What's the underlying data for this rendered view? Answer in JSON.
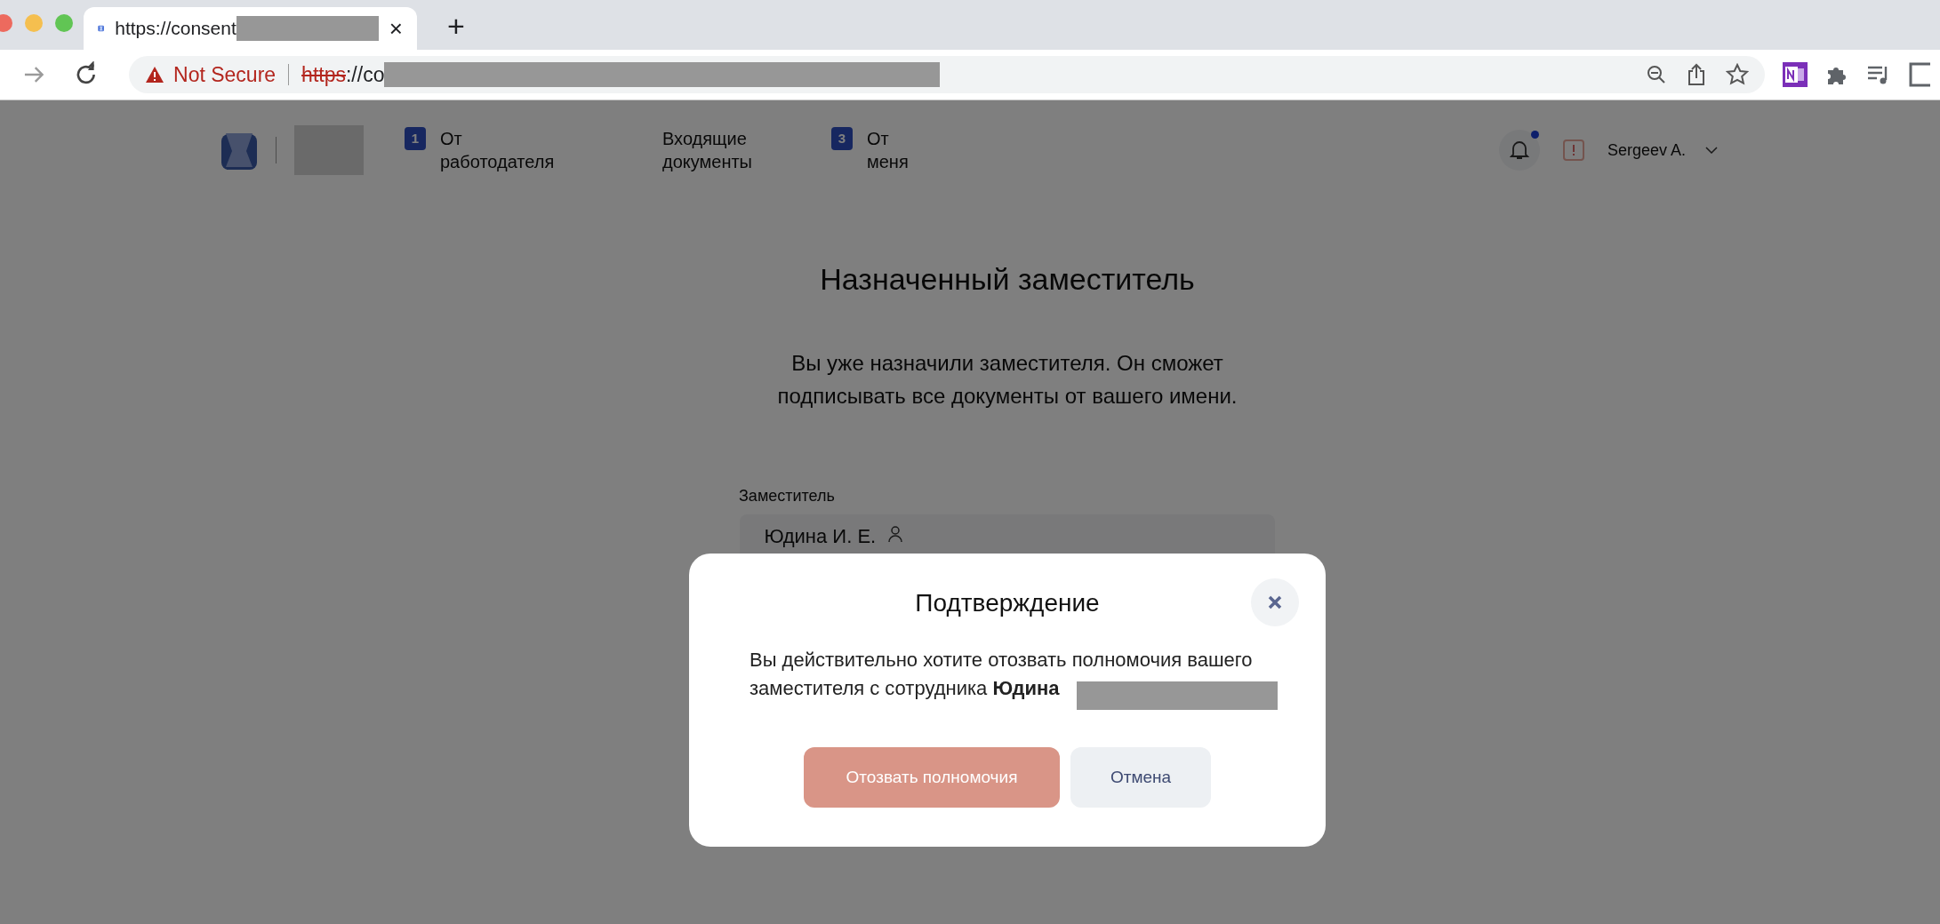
{
  "browser": {
    "tab_title": "https://consent",
    "tab_close": "×",
    "new_tab": "+",
    "security": "Not Secure",
    "url_scheme": "https",
    "url_rest": "://co"
  },
  "header": {
    "nav": [
      {
        "badge": "1",
        "label": "От работодателя"
      },
      {
        "label": "Входящие документы"
      },
      {
        "badge": "3",
        "label": "От меня"
      }
    ],
    "notifications": {
      "unread": true
    },
    "user": "Sergeev A."
  },
  "main": {
    "title": "Назначенный заместитель",
    "description": "Вы уже назначили заместителя. Он сможет подписывать все документы от вашего имени.",
    "field_label": "Заместитель",
    "field_value": "Юдина И. Е."
  },
  "dialog": {
    "title": "Подтверждение",
    "message": "Вы действительно хотите отозвать полномочия вашего заместителя с сотрудника **Юдина**",
    "buttons": [
      {
        "label": "Отозвать полномочия",
        "kind": "primary"
      },
      {
        "label": "Отмена",
        "kind": "secondary"
      }
    ]
  }
}
